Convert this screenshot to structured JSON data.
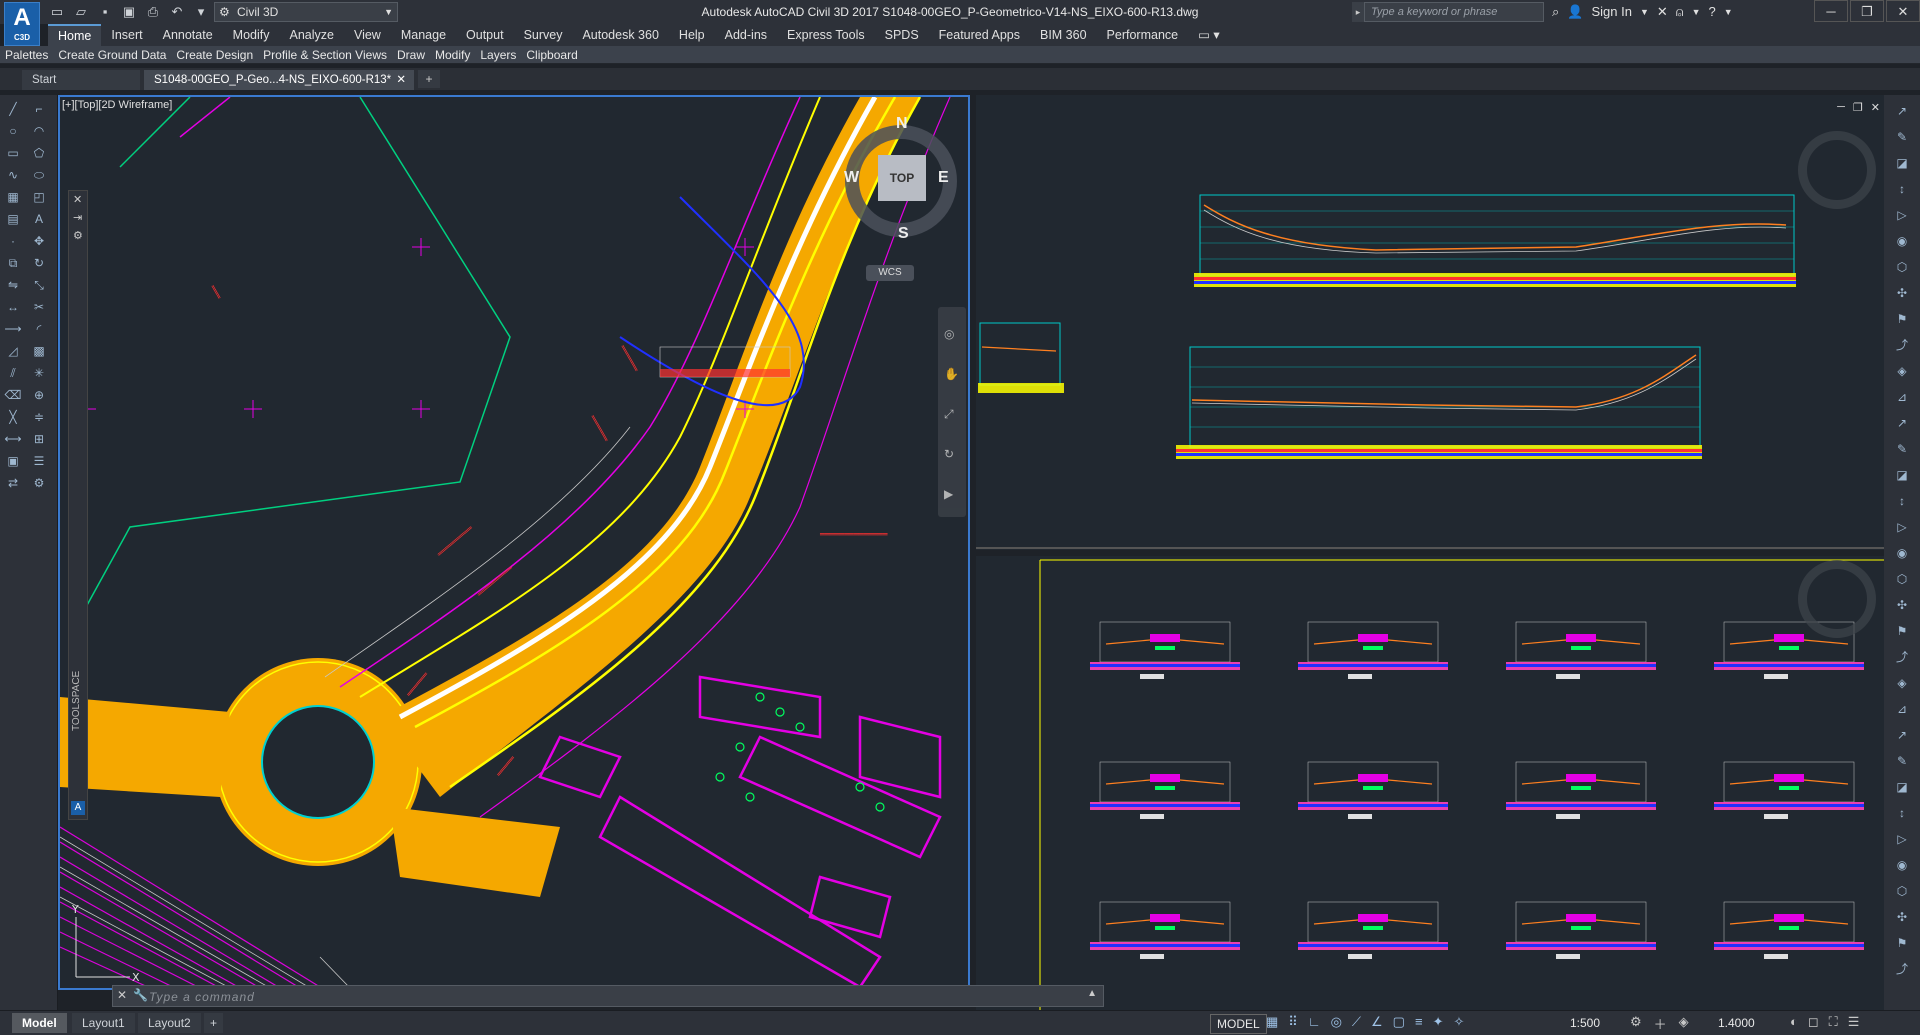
{
  "titlebar": {
    "logo_letter": "A",
    "logo_sub": "C3D",
    "workspace": "Civil 3D",
    "title": "Autodesk AutoCAD Civil 3D 2017    S1048-00GEO_P-Geometrico-V14-NS_EIXO-600-R13.dwg",
    "search_placeholder": "Type a keyword or phrase",
    "signin": "Sign In"
  },
  "ribbon_tabs": [
    "Home",
    "Insert",
    "Annotate",
    "Modify",
    "Analyze",
    "View",
    "Manage",
    "Output",
    "Survey",
    "Autodesk 360",
    "Help",
    "Add-ins",
    "Express Tools",
    "SPDS",
    "Featured Apps",
    "BIM 360",
    "Performance"
  ],
  "active_tab": "Home",
  "ribbon_panels": [
    "Palettes",
    "Create Ground Data",
    "Create Design",
    "Profile & Section Views",
    "Draw",
    "Modify",
    "Layers",
    "Clipboard"
  ],
  "doc_tabs": {
    "start": "Start",
    "active": "S1048-00GEO_P-Geo...4-NS_EIXO-600-R13*"
  },
  "viewport": {
    "label": "[+][Top][2D Wireframe]",
    "viewcube_top": "TOP",
    "north": "N",
    "south": "S",
    "east": "E",
    "west": "W",
    "wcs": "WCS"
  },
  "toolspace_label": "TOOLSPACE",
  "command_placeholder": "Type a command",
  "layout_tabs": [
    "Model",
    "Layout1",
    "Layout2"
  ],
  "status": {
    "model": "MODEL",
    "scale": "1:500",
    "annotation_value": "1.4000"
  },
  "colors": {
    "viewport_bg": "#212830",
    "active_border": "#3a7ad0",
    "road_fill": "#f5a800",
    "magenta": "#e400e4",
    "yellow": "#ffff00",
    "red": "#ff2020",
    "cyan": "#00e5e5",
    "green": "#00ff60"
  }
}
